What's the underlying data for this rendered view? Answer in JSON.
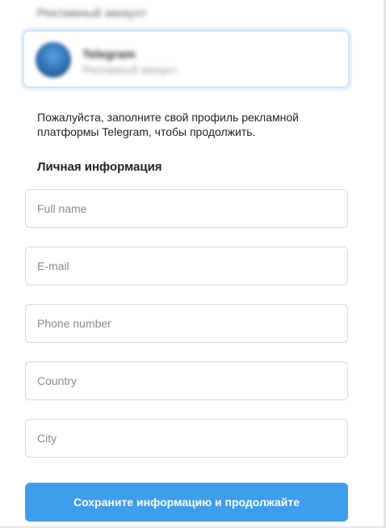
{
  "header": {
    "blurred_title": "Рекламный аккаунт"
  },
  "account": {
    "name": "Telegram",
    "subtitle": "Рекламный аккаунт"
  },
  "intro_text": "Пожалуйста, заполните свой профиль рекламной платформы Telegram, чтобы продолжить.",
  "section_title": "Личная информация",
  "fields": {
    "full_name": {
      "placeholder": "Full name",
      "value": ""
    },
    "email": {
      "placeholder": "E-mail",
      "value": ""
    },
    "phone": {
      "placeholder": "Phone number",
      "value": ""
    },
    "country": {
      "placeholder": "Country",
      "value": ""
    },
    "city": {
      "placeholder": "City",
      "value": ""
    }
  },
  "submit_label": "Сохраните информацию и продолжайте",
  "colors": {
    "accent": "#3e9ded",
    "card_border": "#cfe4fb",
    "field_border": "#d9d9d9",
    "placeholder": "#8a8a8a"
  },
  "icons": {
    "account_avatar": "account-avatar-icon"
  }
}
